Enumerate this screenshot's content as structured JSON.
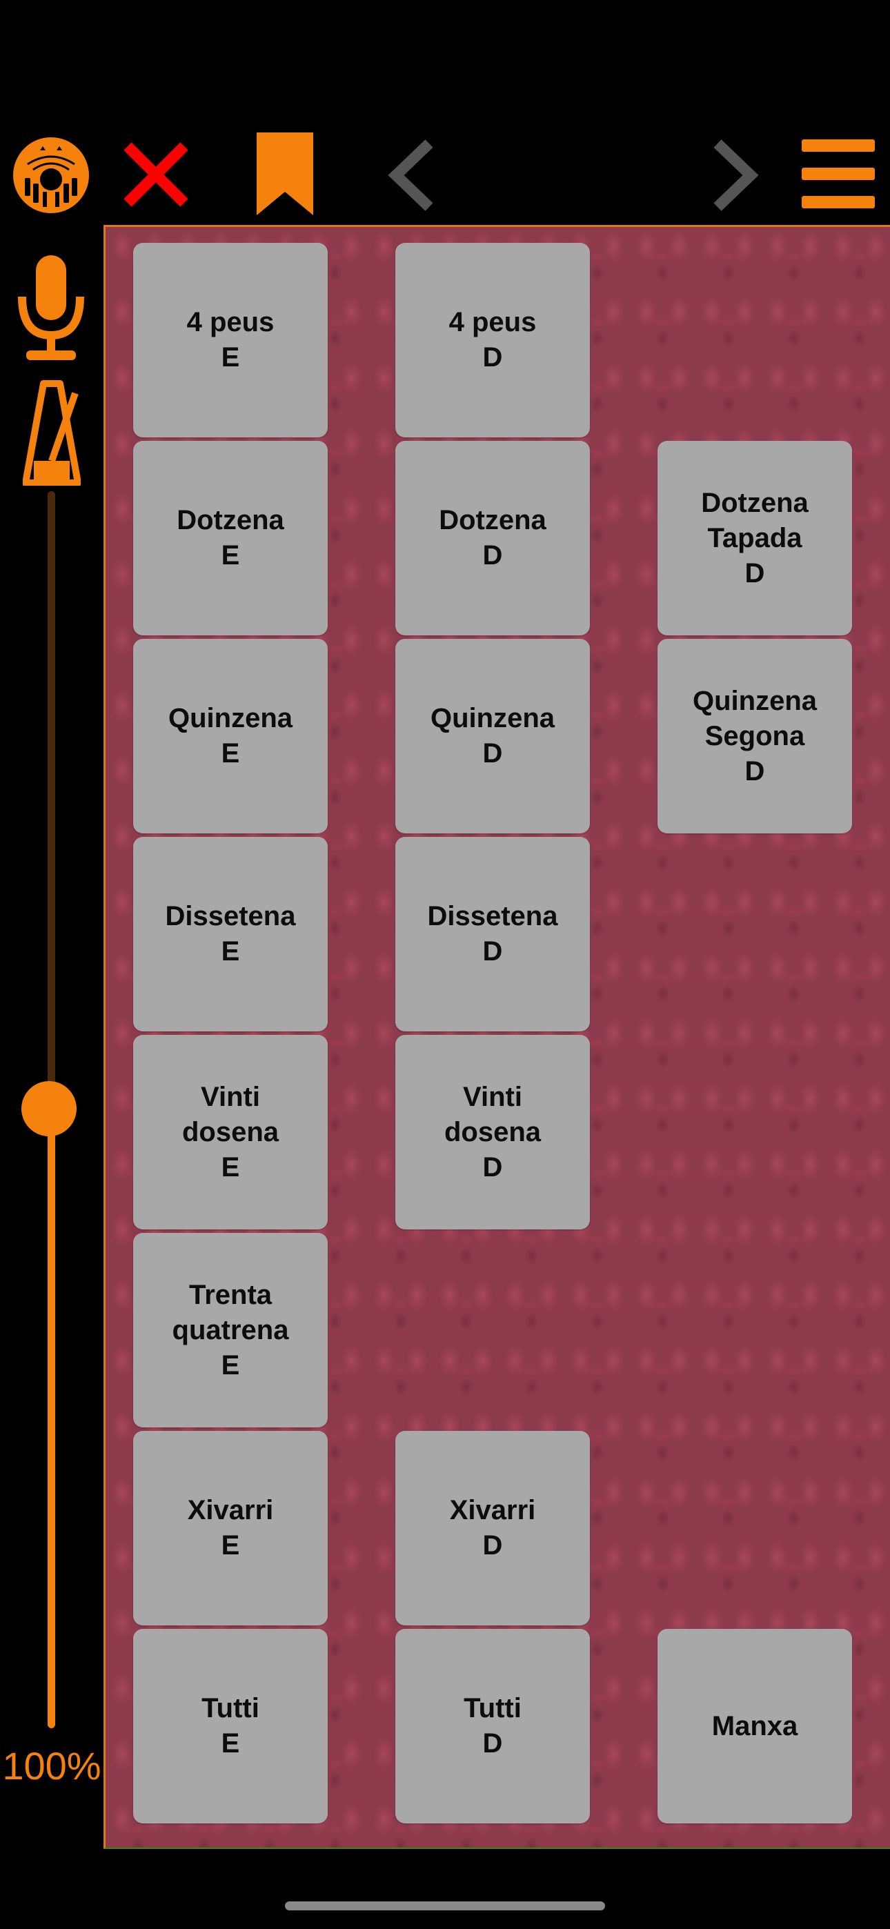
{
  "toolbar": {
    "icons": [
      "organ-logo-icon",
      "close-icon",
      "bookmark-icon",
      "chevron-left-icon",
      "chevron-right-icon",
      "menu-icon"
    ],
    "accent": "#f5820d",
    "close_color": "#ff0000",
    "disabled_color": "#555555"
  },
  "sidebar": {
    "icons": [
      "microphone-icon",
      "metronome-icon"
    ],
    "volume_label": "100%",
    "volume_fraction": 0.5
  },
  "stage": {
    "columns": [
      {
        "stops": [
          {
            "label": "4 peus\nE"
          },
          {
            "label": "Dotzena\nE"
          },
          {
            "label": "Quinzena\nE"
          },
          {
            "label": "Dissetena\nE"
          },
          {
            "label": "Vinti\ndosena\nE"
          },
          {
            "label": "Trenta\nquatrena\nE"
          },
          {
            "label": "Xivarri\nE"
          },
          {
            "label": "Tutti\nE"
          }
        ]
      },
      {
        "stops": [
          {
            "label": "4 peus\nD"
          },
          {
            "label": "Dotzena\nD"
          },
          {
            "label": "Quinzena\nD"
          },
          {
            "label": "Dissetena\nD"
          },
          {
            "label": "Vinti\ndosena\nD"
          },
          {
            "label": "Xivarri\nD"
          },
          {
            "label": "Tutti\nD"
          }
        ]
      },
      {
        "stops": [
          {
            "label": "Dotzena\nTapada\nD"
          },
          {
            "label": "Quinzena\nSegona\nD"
          },
          {
            "label": "Manxa"
          }
        ]
      }
    ]
  },
  "colors": {
    "stop_bg": "#a8a8a8",
    "stop_text": "#0c0c0c",
    "stage_bg": "#8c3a4c",
    "stage_border": "#d9781c",
    "background": "#000000"
  }
}
